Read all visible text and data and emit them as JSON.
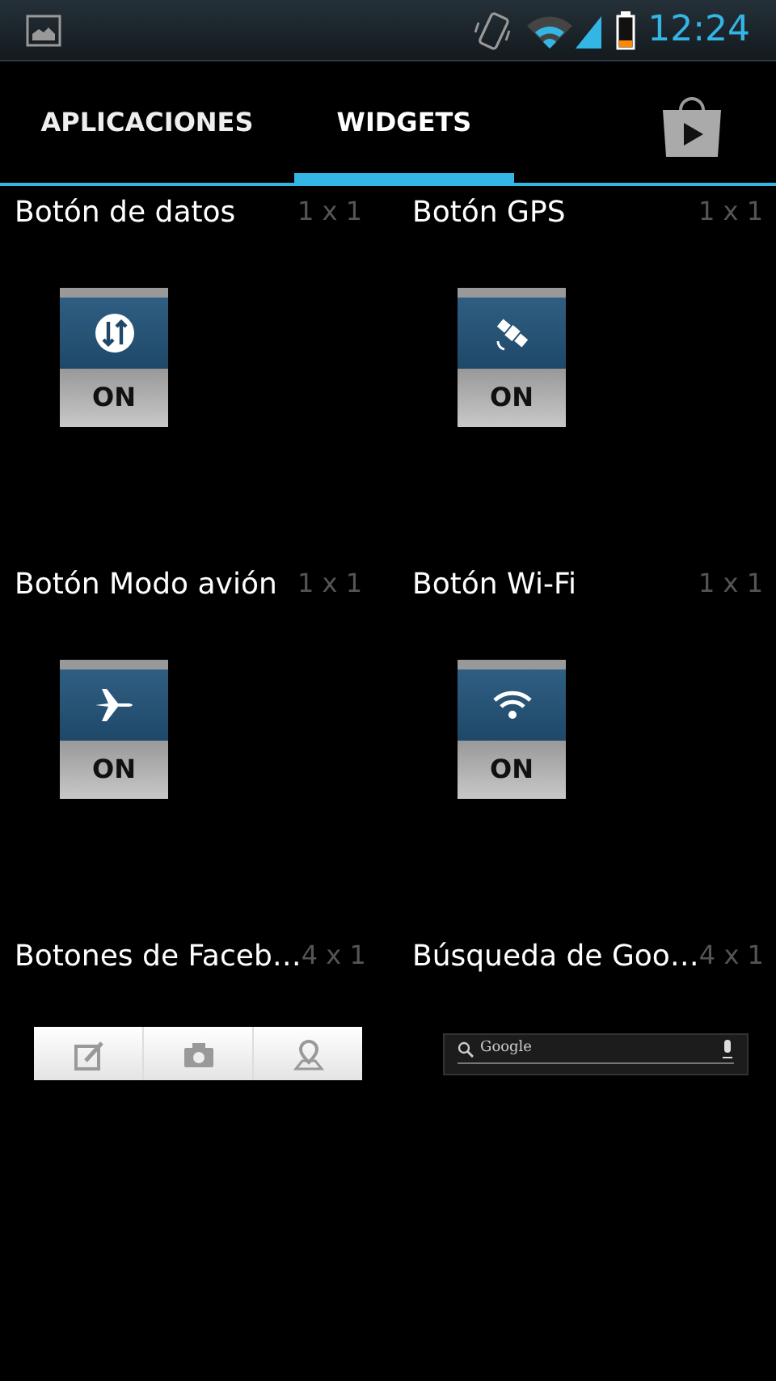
{
  "status_bar": {
    "time": "12:24"
  },
  "tabs": [
    {
      "label": "APLICACIONES",
      "selected": false
    },
    {
      "label": "WIDGETS",
      "selected": true
    }
  ],
  "widgets": [
    {
      "name": "Botón de datos",
      "size": "1 x 1",
      "kind": "data",
      "state_label": "ON"
    },
    {
      "name": "Botón GPS",
      "size": "1 x 1",
      "kind": "gps",
      "state_label": "ON"
    },
    {
      "name": "Botón Modo avión",
      "size": "1 x 1",
      "kind": "plane",
      "state_label": "ON"
    },
    {
      "name": "Botón Wi-Fi",
      "size": "1 x 1",
      "kind": "wifi",
      "state_label": "ON"
    },
    {
      "name": "Botones de Faceb…",
      "size": "4 x 1",
      "kind": "facebook"
    },
    {
      "name": "Búsqueda de Goo…",
      "size": "4 x 1",
      "kind": "search",
      "search_hint": "Google"
    }
  ]
}
